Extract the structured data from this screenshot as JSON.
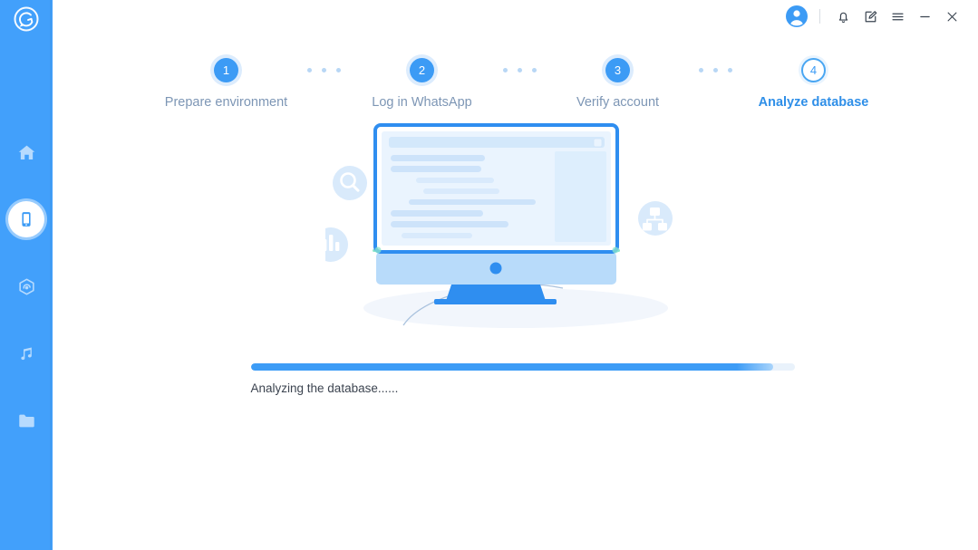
{
  "app": {
    "logo_icon": "chat-bubble-logo-icon",
    "accent_color": "#42a0fb",
    "sidebar_color": "#42a0fb",
    "active_step_color": "#2f8fe8",
    "inactive_step_color": "#7d96b5"
  },
  "sidebar": {
    "items": [
      {
        "name": "home",
        "icon": "home-icon",
        "active": false
      },
      {
        "name": "device",
        "icon": "phone-device-icon",
        "active": true
      },
      {
        "name": "backup",
        "icon": "cloud-backup-icon",
        "active": false
      },
      {
        "name": "music",
        "icon": "music-note-icon",
        "active": false
      },
      {
        "name": "files",
        "icon": "folder-icon",
        "active": false
      }
    ]
  },
  "titlebar": {
    "avatar_icon": "user-avatar-icon",
    "buttons": [
      {
        "name": "notifications",
        "icon": "bell-icon"
      },
      {
        "name": "feedback",
        "icon": "edit-note-icon"
      },
      {
        "name": "menu",
        "icon": "hamburger-menu-icon"
      },
      {
        "name": "minimize",
        "icon": "minimize-icon"
      },
      {
        "name": "close",
        "icon": "close-icon"
      }
    ]
  },
  "stepper": {
    "steps": [
      {
        "number": "1",
        "label": "Prepare environment",
        "state": "done"
      },
      {
        "number": "2",
        "label": "Log in WhatsApp",
        "state": "done"
      },
      {
        "number": "3",
        "label": "Verify account",
        "state": "done"
      },
      {
        "number": "4",
        "label": "Analyze database",
        "state": "active"
      }
    ]
  },
  "illustration": {
    "name": "database-analysis-illustration",
    "badges": [
      {
        "name": "search-badge",
        "icon": "magnifier-icon"
      },
      {
        "name": "statistics-badge",
        "icon": "bar-chart-icon"
      },
      {
        "name": "hierarchy-badge",
        "icon": "sitemap-icon"
      }
    ],
    "monitor": "desktop-monitor-with-document"
  },
  "progress": {
    "percent": 96,
    "status_text": "Analyzing the database......"
  }
}
